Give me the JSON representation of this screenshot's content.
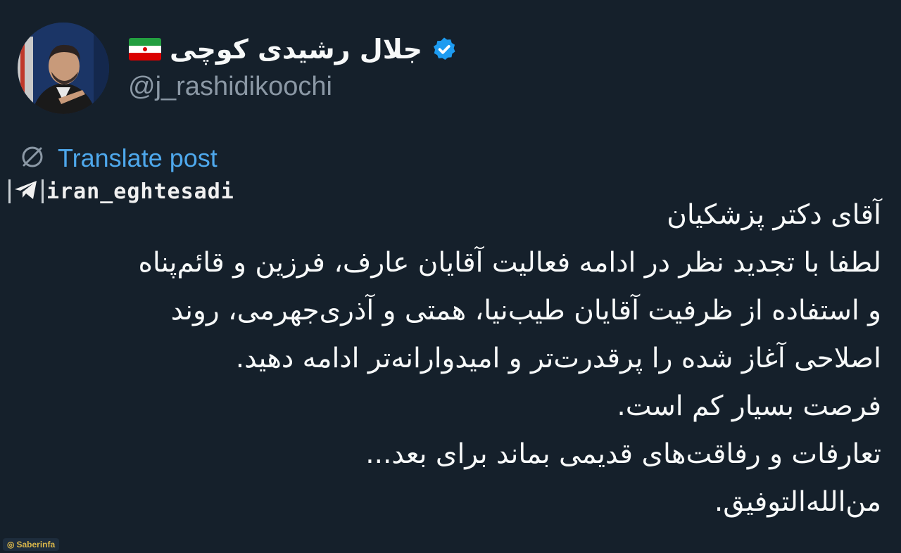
{
  "author": {
    "display_name": "جلال رشیدی کوچی",
    "handle": "@j_rashidikoochi",
    "flag_icon": "iran-flag-icon",
    "verified_icon": "verified-badge-icon",
    "verified_color": "#1d9bf0"
  },
  "translate": {
    "label": "Translate post",
    "icon": "globe-translate-icon",
    "color": "#4ea8ec"
  },
  "watermark": {
    "icon": "telegram-icon",
    "text": "iran_eghtesadi"
  },
  "tweet": {
    "lines": [
      "آقای دکتر پزشکیان",
      "لطفا با تجدید نظر در ادامه فعالیت آقایان عارف، فرزین و قائم‌پناه",
      "و استفاده از ظرفیت آقایان طیب‌نیا، همتی و آذری‌جهرمی، روند",
      "اصلاحی آغاز شده را پرقدرت‌تر و امیدوارانه‌تر ادامه دهید.",
      "فرصت بسیار کم است.",
      "تعارفات و رفاقت‌های قدیمی بماند برای بعد...",
      "من‌الله‌التوفیق."
    ]
  },
  "corner_watermark": {
    "text": "Saberinfa"
  },
  "colors": {
    "background": "#15202b",
    "text": "#f7f9f9",
    "secondary_text": "#8b98a5",
    "link": "#4ea8ec"
  }
}
